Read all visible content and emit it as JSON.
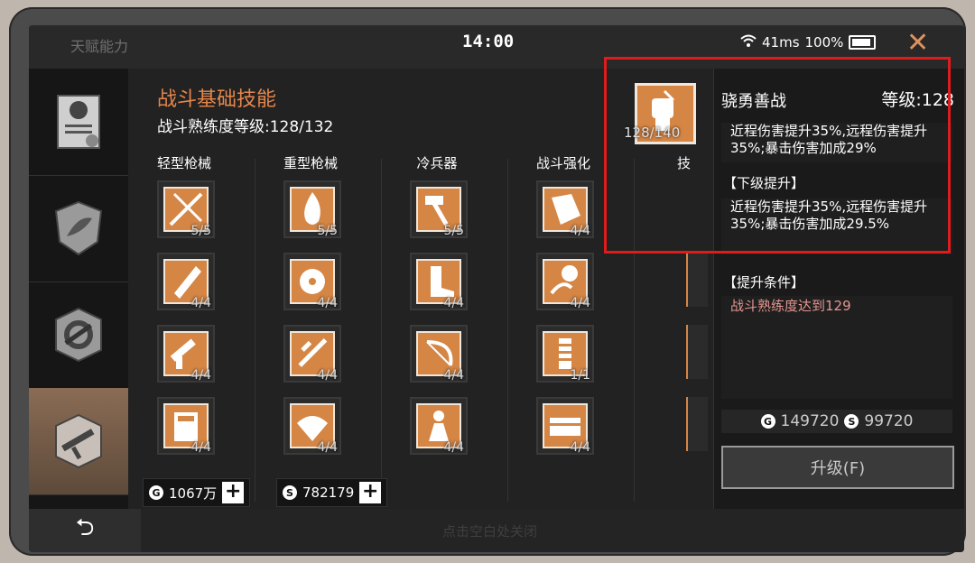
{
  "topbar": {
    "title": "天赋能力",
    "time": "14:00",
    "ping": "41ms",
    "battery": "100%"
  },
  "main": {
    "title": "战斗基础技能",
    "subtitle": "战斗熟练度等级:128/132",
    "columns": [
      "轻型枪械",
      "重型枪械",
      "冷兵器",
      "战斗强化",
      "技"
    ],
    "rows": [
      [
        "5/5",
        "5/5",
        "5/5",
        "4/4"
      ],
      [
        "4/4",
        "4/4",
        "4/4",
        "4/4"
      ],
      [
        "4/4",
        "4/4",
        "4/4",
        "1/1"
      ],
      [
        "4/4",
        "4/4",
        "4/4",
        "4/4"
      ]
    ]
  },
  "currency": {
    "gold": "1067万",
    "silver": "782179",
    "plus": "+"
  },
  "detail": {
    "icon_level": "128/140",
    "name": "骁勇善战",
    "level": "等级:128",
    "current_effect": "近程伤害提升35%,远程伤害提升35%;暴击伤害加成29%",
    "next_header": "【下级提升】",
    "next_effect": "近程伤害提升35%,远程伤害提升35%;暴击伤害加成29.5%",
    "cond_header": "【提升条件】",
    "condition": "战斗熟练度达到129",
    "balance_gold": "149720",
    "balance_silver": "99720",
    "upgrade_label": "升级(F)"
  },
  "bottom": {
    "hint": "点击空白处关闭",
    "back": "⮌"
  },
  "colors": {
    "accent": "#e5864b",
    "highlight": "#e01b1b",
    "condition": "#e59690"
  }
}
